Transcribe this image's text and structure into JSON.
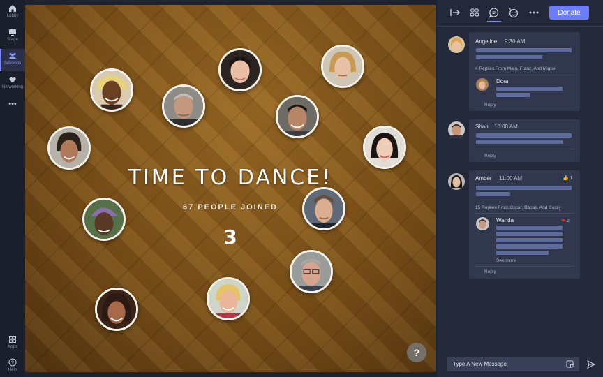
{
  "nav": {
    "items": [
      {
        "label": "Lobby",
        "icon": "home-icon"
      },
      {
        "label": "Stage",
        "icon": "stage-icon"
      },
      {
        "label": "Sessions",
        "icon": "sessions-icon",
        "active": true
      },
      {
        "label": "Networking",
        "icon": "handshake-icon"
      }
    ],
    "more": "•••",
    "bottom": [
      {
        "label": "Apps",
        "icon": "apps-icon"
      },
      {
        "label": "Help",
        "icon": "help-icon"
      }
    ]
  },
  "stage": {
    "title": "TIME TO DANCE!",
    "subtitle": "67 PEOPLE JOINED",
    "countdown": "3",
    "help_button": "?"
  },
  "toolbar": {
    "donate_label": "Donate",
    "icons": [
      "exit-icon",
      "people-icon",
      "chat-icon",
      "emoji-icon",
      "more-icon"
    ]
  },
  "chat": {
    "messages": [
      {
        "name": "Angeline",
        "time": "9:30 AM",
        "replies_summary": "4 Replies From Maja, Franz, And Miguel",
        "reply": {
          "name": "Dora"
        },
        "reply_label": "Reply"
      },
      {
        "name": "Shan",
        "time": "10:00 AM",
        "reply_label": "Reply"
      },
      {
        "name": "Amber",
        "time": "11:00 AM",
        "reaction": {
          "icon": "thumbs-up-icon",
          "emoji": "👍",
          "count": "1"
        },
        "replies_summary": "15 Replies From Oscar, Babak, And Cecily",
        "reply": {
          "name": "Wanda",
          "reaction": {
            "icon": "heart-icon",
            "emoji": "❤",
            "count": "2"
          },
          "see_more": "See more"
        },
        "reply_label": "Reply"
      }
    ],
    "composer_placeholder": "Type A New Message"
  },
  "colors": {
    "accent": "#6b7cff",
    "panel_bg": "#23283a",
    "card_bg": "#31374c",
    "placeholder_bar": "#5d6a9c"
  }
}
